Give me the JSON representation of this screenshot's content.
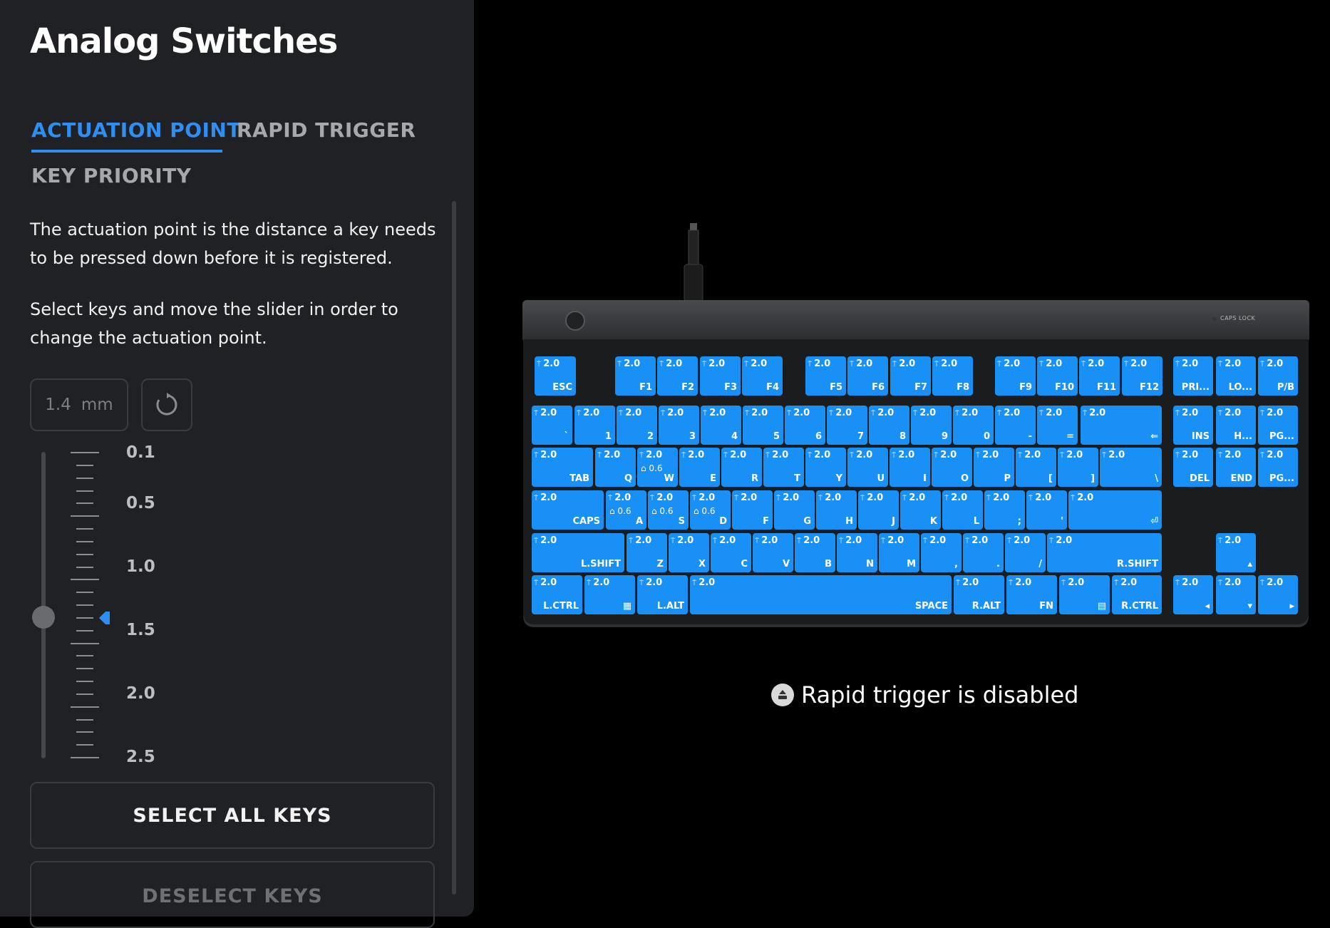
{
  "panel": {
    "title": "Analog Switches",
    "tabs": [
      "ACTUATION POINT",
      "RAPID TRIGGER",
      "KEY PRIORITY"
    ],
    "description_1": "The actuation point is the distance a key needs to be pressed down before it is registered.",
    "description_2": "Select keys and move the slider in order to change the actuation point.",
    "value": "1.4",
    "unit": "mm",
    "scale_labels": [
      "0.1",
      "0.5",
      "1.0",
      "1.5",
      "2.0",
      "2.5"
    ],
    "select_all_label": "SELECT ALL KEYS",
    "deselect_label": "DESELECT KEYS"
  },
  "slider": {
    "min": 0.1,
    "max": 2.5,
    "value": 1.4
  },
  "keyboard": {
    "caps_lock_label": "CAPS LOCK",
    "colors": {
      "key": "#1890f5",
      "accent": "#2e8ef2"
    },
    "rows": [
      [
        {
          "label": "ESC",
          "act": "2.0"
        },
        {
          "label": "F1",
          "act": "2.0"
        },
        {
          "label": "F2",
          "act": "2.0"
        },
        {
          "label": "F3",
          "act": "2.0"
        },
        {
          "label": "F4",
          "act": "2.0"
        },
        {
          "label": "F5",
          "act": "2.0"
        },
        {
          "label": "F6",
          "act": "2.0"
        },
        {
          "label": "F7",
          "act": "2.0"
        },
        {
          "label": "F8",
          "act": "2.0"
        },
        {
          "label": "F9",
          "act": "2.0"
        },
        {
          "label": "F10",
          "act": "2.0"
        },
        {
          "label": "F11",
          "act": "2.0"
        },
        {
          "label": "F12",
          "act": "2.0"
        },
        {
          "label": "PRI...",
          "act": "2.0"
        },
        {
          "label": "LO...",
          "act": "2.0"
        },
        {
          "label": "P/B",
          "act": "2.0"
        }
      ],
      [
        {
          "label": "`",
          "act": "2.0"
        },
        {
          "label": "1",
          "act": "2.0"
        },
        {
          "label": "2",
          "act": "2.0"
        },
        {
          "label": "3",
          "act": "2.0"
        },
        {
          "label": "4",
          "act": "2.0"
        },
        {
          "label": "5",
          "act": "2.0"
        },
        {
          "label": "6",
          "act": "2.0"
        },
        {
          "label": "7",
          "act": "2.0"
        },
        {
          "label": "8",
          "act": "2.0"
        },
        {
          "label": "9",
          "act": "2.0"
        },
        {
          "label": "0",
          "act": "2.0"
        },
        {
          "label": "-",
          "act": "2.0"
        },
        {
          "label": "=",
          "act": "2.0"
        },
        {
          "label": "⇐",
          "act": "2.0"
        },
        {
          "label": "INS",
          "act": "2.0"
        },
        {
          "label": "H...",
          "act": "2.0"
        },
        {
          "label": "PG...",
          "act": "2.0"
        }
      ],
      [
        {
          "label": "TAB",
          "act": "2.0"
        },
        {
          "label": "Q",
          "act": "2.0"
        },
        {
          "label": "W",
          "act": "2.0",
          "rt": "0.6"
        },
        {
          "label": "E",
          "act": "2.0"
        },
        {
          "label": "R",
          "act": "2.0"
        },
        {
          "label": "T",
          "act": "2.0"
        },
        {
          "label": "Y",
          "act": "2.0"
        },
        {
          "label": "U",
          "act": "2.0"
        },
        {
          "label": "I",
          "act": "2.0"
        },
        {
          "label": "O",
          "act": "2.0"
        },
        {
          "label": "P",
          "act": "2.0"
        },
        {
          "label": "[",
          "act": "2.0"
        },
        {
          "label": "]",
          "act": "2.0"
        },
        {
          "label": "\\",
          "act": "2.0"
        },
        {
          "label": "DEL",
          "act": "2.0"
        },
        {
          "label": "END",
          "act": "2.0"
        },
        {
          "label": "PG...",
          "act": "2.0"
        }
      ],
      [
        {
          "label": "CAPS",
          "act": "2.0"
        },
        {
          "label": "A",
          "act": "2.0",
          "rt": "0.6"
        },
        {
          "label": "S",
          "act": "2.0",
          "rt": "0.6"
        },
        {
          "label": "D",
          "act": "2.0",
          "rt": "0.6"
        },
        {
          "label": "F",
          "act": "2.0"
        },
        {
          "label": "G",
          "act": "2.0"
        },
        {
          "label": "H",
          "act": "2.0"
        },
        {
          "label": "J",
          "act": "2.0"
        },
        {
          "label": "K",
          "act": "2.0"
        },
        {
          "label": "L",
          "act": "2.0"
        },
        {
          "label": ";",
          "act": "2.0"
        },
        {
          "label": "'",
          "act": "2.0"
        },
        {
          "label": "⏎",
          "act": "2.0"
        }
      ],
      [
        {
          "label": "L.SHIFT",
          "act": "2.0"
        },
        {
          "label": "Z",
          "act": "2.0"
        },
        {
          "label": "X",
          "act": "2.0"
        },
        {
          "label": "C",
          "act": "2.0"
        },
        {
          "label": "V",
          "act": "2.0"
        },
        {
          "label": "B",
          "act": "2.0"
        },
        {
          "label": "N",
          "act": "2.0"
        },
        {
          "label": "M",
          "act": "2.0"
        },
        {
          "label": ",",
          "act": "2.0"
        },
        {
          "label": ".",
          "act": "2.0"
        },
        {
          "label": "/",
          "act": "2.0"
        },
        {
          "label": "R.SHIFT",
          "act": "2.0"
        },
        {
          "label": "▴",
          "act": "2.0"
        }
      ],
      [
        {
          "label": "L.CTRL",
          "act": "2.0"
        },
        {
          "label": "▦",
          "act": "2.0"
        },
        {
          "label": "L.ALT",
          "act": "2.0"
        },
        {
          "label": "SPACE",
          "act": "2.0"
        },
        {
          "label": "R.ALT",
          "act": "2.0"
        },
        {
          "label": "FN",
          "act": "2.0"
        },
        {
          "label": "▤",
          "act": "2.0"
        },
        {
          "label": "R.CTRL",
          "act": "2.0"
        },
        {
          "label": "◂",
          "act": "2.0"
        },
        {
          "label": "▾",
          "act": "2.0"
        },
        {
          "label": "▸",
          "act": "2.0"
        }
      ]
    ]
  },
  "status": {
    "text": "Rapid trigger is disabled",
    "icon": "rapid-trigger-icon"
  }
}
